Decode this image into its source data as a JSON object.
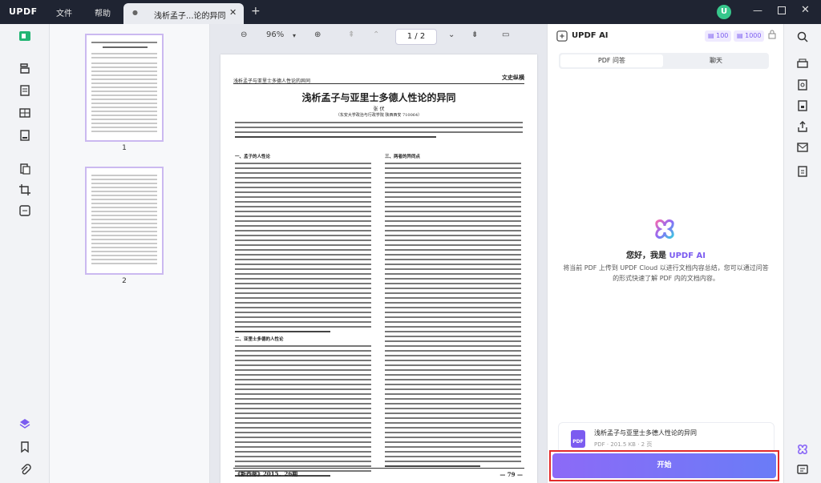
{
  "app": {
    "logo": "UPDF",
    "menu": {
      "file": "文件",
      "help": "帮助"
    },
    "tab_title": "浅析孟子...论的异同",
    "user_initial": "U"
  },
  "viewer": {
    "zoom": "96%",
    "page_indicator": "1 / 2",
    "thumbnails": [
      "1",
      "2"
    ]
  },
  "document": {
    "header_left": "浅析孟子与亚里士多德人性论的异同",
    "header_right": "文史纵横",
    "title": "浅析孟子与亚里士多德人性论的异同",
    "author": "张 伏",
    "affiliation": "（东安大学政治与行政学院  陕西西安  710064）",
    "section_1": "一、孟子的人性论",
    "section_2": "二、亚里士多德的人性论",
    "section_3": "三、两者的异同点",
    "footer_left": "《新西部》2015．26期",
    "footer_right": "— 79 —"
  },
  "ai": {
    "title": "UPDF AI",
    "credit_1": "100",
    "credit_2": "1000",
    "tab_pdf": "PDF 问答",
    "tab_chat": "聊天",
    "greeting_prefix": "您好，我是",
    "greeting_brand": "UPDF AI",
    "description": "将当前 PDF 上传到 UPDF Cloud 以进行文档内容总结，您可以通过问答的形式快速了解 PDF 内的文档内容。",
    "file_name": "浅析孟子与亚里士多德人性论的异同",
    "file_meta": "PDF · 201.5 KB · 2 页",
    "file_icon_text": "PDF",
    "start_button": "开始"
  },
  "colors": {
    "accent": "#7b5cf0",
    "titlebar": "#1f2432",
    "highlight": "#e22b2b"
  }
}
